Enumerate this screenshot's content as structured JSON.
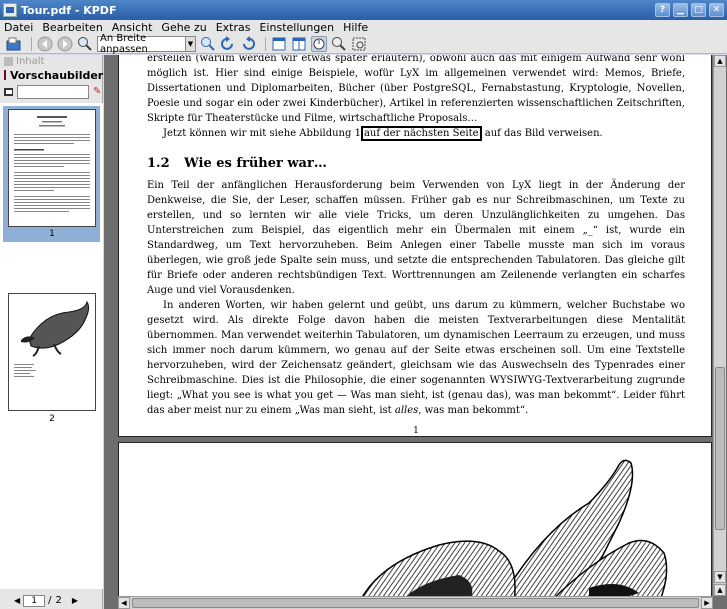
{
  "window": {
    "title": "Tour.pdf - KPDF",
    "buttons": {
      "help": "?",
      "minimize": "▁",
      "maximize": "□",
      "close": "✕"
    }
  },
  "menu": [
    "Datei",
    "Bearbeiten",
    "Ansicht",
    "Gehe zu",
    "Extras",
    "Einstellungen",
    "Hilfe"
  ],
  "toolbar": {
    "zoom_value": "An Breite anpassen"
  },
  "sidebar": {
    "tab_inactive": "Inhalt",
    "tab_active": "Vorschaubilder",
    "thumb_labels": [
      "1",
      "2"
    ],
    "pager": {
      "current": "1",
      "sep": "/",
      "total": "2"
    }
  },
  "page1": {
    "para1": "erstellen (warum werden wir etwas später erläutern), obwohl auch das mit einigem Aufwand sehr wohl möglich ist. Hier sind einige Beispiele, wofür LyX im allgemeinen verwendet wird: Memos, Briefe, Dissertationen und Diplomarbeiten, Bücher (über PostgreSQL, Fernabstastung, Kryptologie, Novellen, Poesie und sogar ein oder zwei Kinderbücher), Artikel in referenzierten wissenschaftlichen Zeitschriften, Skripte für Theaterstücke und Filme, wirtschaftliche Proposals…",
    "para2_before": "Jetzt können wir mit siehe Abbildung 1",
    "para2_link": "auf der nächsten Seite",
    "para2_after": "auf das Bild verweisen.",
    "section_number": "1.2",
    "section_title": "Wie es früher war…",
    "para3": "Ein Teil der anfänglichen Herausforderung beim Verwenden von LyX liegt in der Änderung der Denkweise, die Sie, der Leser, schaffen müssen. Früher gab es nur Schreibmaschinen, um Texte zu erstellen, und so lernten wir alle viele Tricks, um deren Unzulänglichkeiten zu umgehen. Das Unterstreichen zum Beispiel, das eigentlich mehr ein Übermalen mit einem „_“ ist, wurde ein Standardweg, um Text hervorzuheben. Beim Anlegen einer Tabelle musste man sich im voraus überlegen, wie groß jede Spalte sein muss, und setzte die entsprechenden Tabulatoren. Das gleiche gilt für Briefe oder anderen rechtsbündigen Text. Worttrennungen am Zeilenende verlangten ein scharfes Auge und viel Vorausdenken.",
    "para4_main": "In anderen Worten, wir haben gelernt und geübt, uns darum zu kümmern, welcher Buchstabe wo gesetzt wird. Als direkte Folge davon haben die meisten Textverarbeitungen diese Mentalität übernommen. Man verwendet weiterhin Tabulatoren, um dynamischen Leerraum zu erzeugen, und muss sich immer noch darum kümmern, wo genau auf der Seite etwas erscheinen soll. Um eine Textstelle hervorzuheben, wird der Zeichensatz geändert, gleichsam wie das Auswechseln des Typenrades einer Schreibmaschine. Dies ist die Philosophie, die einer sogenannten WYSIWYG-Textverarbeitung zugrunde liegt: „What you see is what you get — Was man sieht, ist (genau das), was man bekommt“. Leider führt das aber meist nur zu einem „Was man sieht, ist",
    "para4_italic": "alles",
    "para4_end": ", was man bekommt“.",
    "page_number": "1"
  },
  "colors": {
    "titlebar_top": "#4f86c8",
    "titlebar_bottom": "#2a5ea7",
    "selected_thumb": "#8fb0d6",
    "viewer_bg": "#6e6e6e"
  }
}
